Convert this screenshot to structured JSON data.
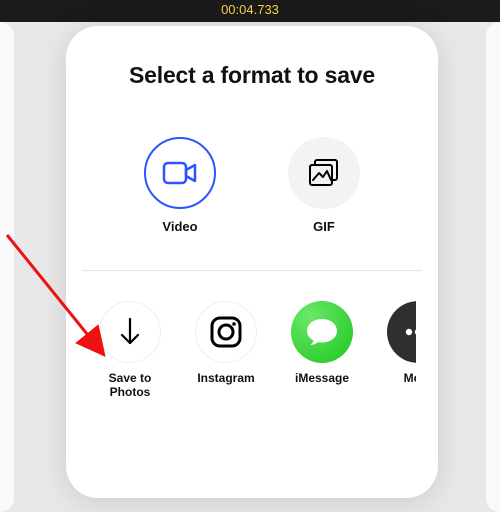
{
  "statusBar": {
    "timestamp": "00:04.733"
  },
  "modal": {
    "title": "Select a format to save",
    "formats": [
      {
        "id": "video",
        "label": "Video",
        "selected": true
      },
      {
        "id": "gif",
        "label": "GIF",
        "selected": false
      }
    ],
    "shares": [
      {
        "id": "save",
        "label": "Save to\nPhotos",
        "style": "outlined",
        "icon": "download-arrow-icon"
      },
      {
        "id": "instagram",
        "label": "Instagram",
        "style": "outlined",
        "icon": "instagram-icon"
      },
      {
        "id": "imessage",
        "label": "iMessage",
        "style": "imsg",
        "icon": "chat-bubble-icon"
      },
      {
        "id": "more",
        "label": "More",
        "style": "more",
        "icon": "ellipsis-icon"
      }
    ]
  },
  "colors": {
    "accent": "#2b56ff",
    "imessage": "#1cc71c"
  }
}
